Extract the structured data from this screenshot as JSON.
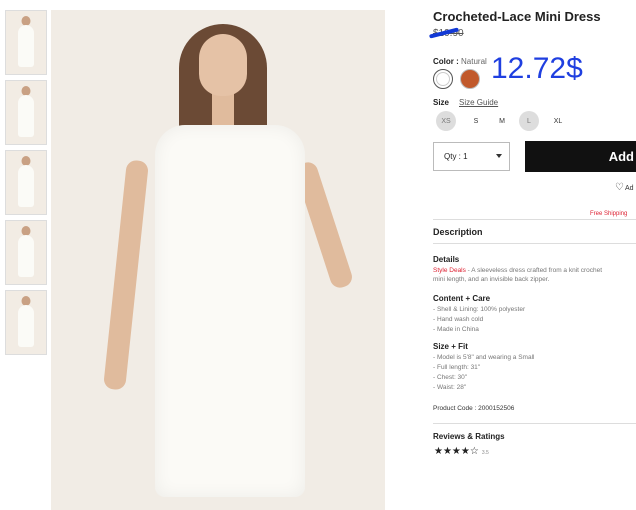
{
  "product": {
    "title": "Crocheted-Lace Mini Dress",
    "old_price": "$19.90",
    "new_price": "12.72$"
  },
  "color": {
    "label": "Color :",
    "value": "Natural",
    "swatches": [
      {
        "name": "Natural",
        "hex": "#ffffff"
      },
      {
        "name": "Rust",
        "hex": "#c1592b"
      }
    ]
  },
  "size": {
    "label": "Size",
    "guide": "Size Guide",
    "options": [
      "XS",
      "S",
      "M",
      "L",
      "XL"
    ]
  },
  "qty": {
    "label": "Qty : 1"
  },
  "add_button": "Add",
  "wishlist": "Ad",
  "free_shipping": "Free Shipping",
  "description": {
    "heading": "Description",
    "details_title": "Details",
    "details_highlight": "Style Deals",
    "details_line1": " - A sleeveless dress crafted from a knit crochet",
    "details_line2": "mini length, and an invisible back zipper.",
    "content_title": "Content + Care",
    "content_lines": [
      "- Shell & Lining: 100% polyester",
      "- Hand wash cold",
      "- Made in China"
    ],
    "fit_title": "Size + Fit",
    "fit_lines": [
      "- Model is 5'8\" and wearing a Small",
      "- Full length: 31\"",
      "- Chest: 30\"",
      "- Waist: 28\""
    ],
    "product_code": "Product Code : 2000152506"
  },
  "reviews": {
    "heading": "Reviews & Ratings",
    "stars": "★★★★☆",
    "rating": 3.5,
    "rating_text": "3.5"
  },
  "colors": {
    "accent_blue": "#1f3fe0",
    "sale_red": "#d23",
    "button_black": "#111111"
  }
}
